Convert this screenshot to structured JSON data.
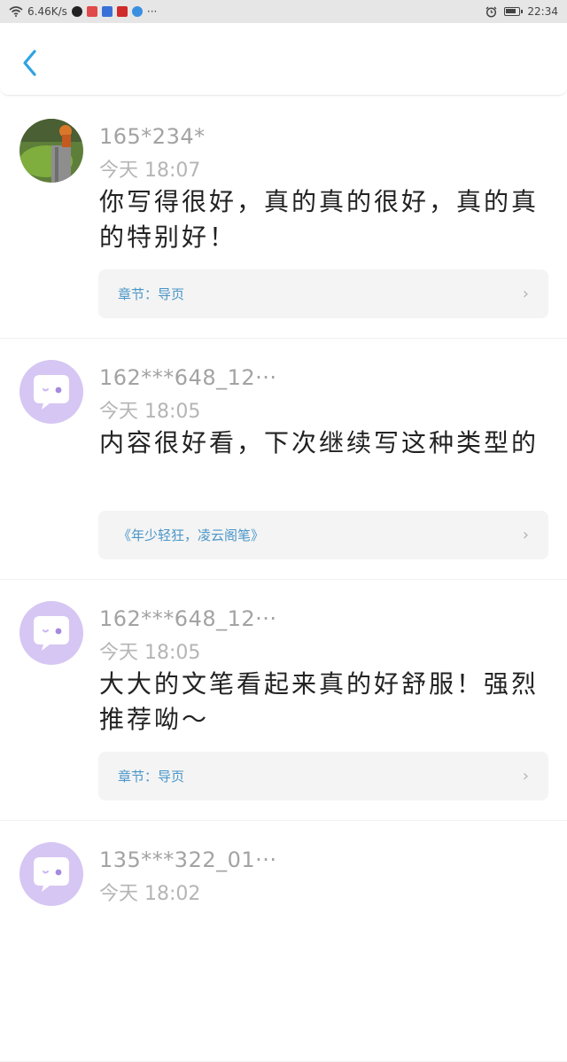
{
  "status_bar": {
    "net_speed": "6.46K/s",
    "more": "···",
    "time": "22:34",
    "app_colors": [
      "#222222",
      "#e04a4a",
      "#3a6fd8",
      "#d02a2a",
      "#3a8fe0"
    ]
  },
  "header": {
    "back_icon": "chevron-left-icon",
    "accent": "#2fa3e3"
  },
  "comments": [
    {
      "user": "165*234*",
      "time": "今天 18:07",
      "text": "你写得很好，真的真的很好，真的真的特别好！",
      "chapter": "章节：导页",
      "avatar": "photo"
    },
    {
      "user": "162***648_12···",
      "time": "今天 18:05",
      "text": "内容很好看，下次继续写这种类型的",
      "chapter": "《年少轻狂，凌云阁笔》",
      "avatar": "chat-bubble"
    },
    {
      "user": "162***648_12···",
      "time": "今天 18:05",
      "text": "大大的文笔看起来真的好舒服！强烈推荐呦～",
      "chapter": "章节：导页",
      "avatar": "chat-bubble"
    },
    {
      "user": "135***322_01···",
      "time": "今天 18:02",
      "avatar": "chat-bubble"
    }
  ]
}
